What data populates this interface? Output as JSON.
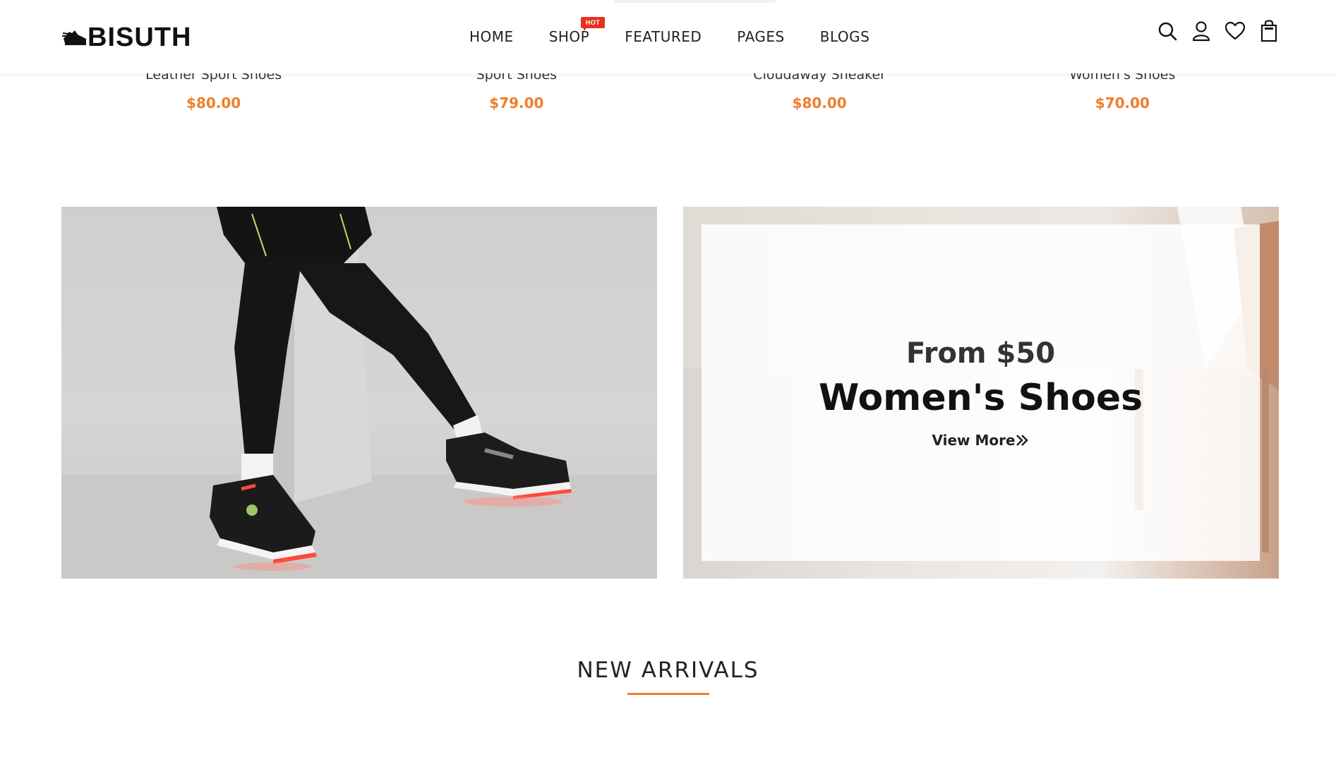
{
  "header": {
    "logo_text": "BISUTH",
    "nav": [
      {
        "label": "HOME"
      },
      {
        "label": "SHOP",
        "badge": "HOT"
      },
      {
        "label": "FEATURED"
      },
      {
        "label": "PAGES"
      },
      {
        "label": "BLOGS"
      }
    ],
    "icons": [
      "search-icon",
      "user-icon",
      "heart-icon",
      "bag-icon"
    ]
  },
  "products": [
    {
      "name": "Leather Sport Shoes",
      "price": "$80.00"
    },
    {
      "name": "Sport Shoes",
      "price": "$79.00"
    },
    {
      "name": "Cloudaway Sneaker",
      "price": "$80.00"
    },
    {
      "name": "Women's Shoes",
      "price": "$70.00"
    }
  ],
  "promo": {
    "subtitle": "From $50",
    "title": "Women's Shoes",
    "link": "View More"
  },
  "section": {
    "title": "NEW ARRIVALS"
  },
  "colors": {
    "accent": "#f07d2b",
    "hot_badge": "#e8321f"
  }
}
